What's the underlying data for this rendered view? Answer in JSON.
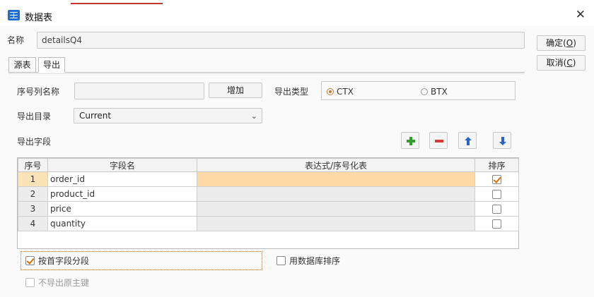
{
  "window": {
    "title": "数据表",
    "close_label": "✕"
  },
  "name_row": {
    "label": "名称",
    "value": "detailsQ4"
  },
  "side_buttons": {
    "ok": "确定",
    "ok_key": "O",
    "cancel": "取消",
    "cancel_key": "C"
  },
  "tabs": [
    {
      "label": "源表"
    },
    {
      "label": "导出"
    }
  ],
  "export": {
    "seq_col_label": "序号列名称",
    "seq_col_value": "",
    "add_button": "增加",
    "type_label": "导出类型",
    "type_options": [
      {
        "label": "CTX",
        "selected": true
      },
      {
        "label": "BTX",
        "selected": false
      }
    ],
    "dir_label": "导出目录",
    "dir_value": "Current",
    "fields_label": "导出字段"
  },
  "toolbar_icons": [
    "add-row-icon",
    "delete-row-icon",
    "move-up-icon",
    "move-down-icon"
  ],
  "table": {
    "headers": [
      "序号",
      "字段名",
      "表达式/序号化表",
      "排序"
    ],
    "rows": [
      {
        "seq": "1",
        "field": "order_id",
        "expr": "",
        "sort": true
      },
      {
        "seq": "2",
        "field": "product_id",
        "expr": "",
        "sort": false
      },
      {
        "seq": "3",
        "field": "price",
        "expr": "",
        "sort": false
      },
      {
        "seq": "4",
        "field": "quantity",
        "expr": "",
        "sort": false
      }
    ]
  },
  "options": {
    "segment_by_first": {
      "label": "按首字段分段",
      "checked": true
    },
    "db_sort": {
      "label": "用数据库排序",
      "checked": false
    },
    "no_export_pk": {
      "label": "不导出原主键",
      "checked": false
    }
  },
  "colors": {
    "accent": "#c8782d",
    "selected_row": "#fcd9a6",
    "add_green": "#2e9e2e",
    "delete_red": "#d23b3b",
    "arrow_blue": "#2b63c6"
  }
}
